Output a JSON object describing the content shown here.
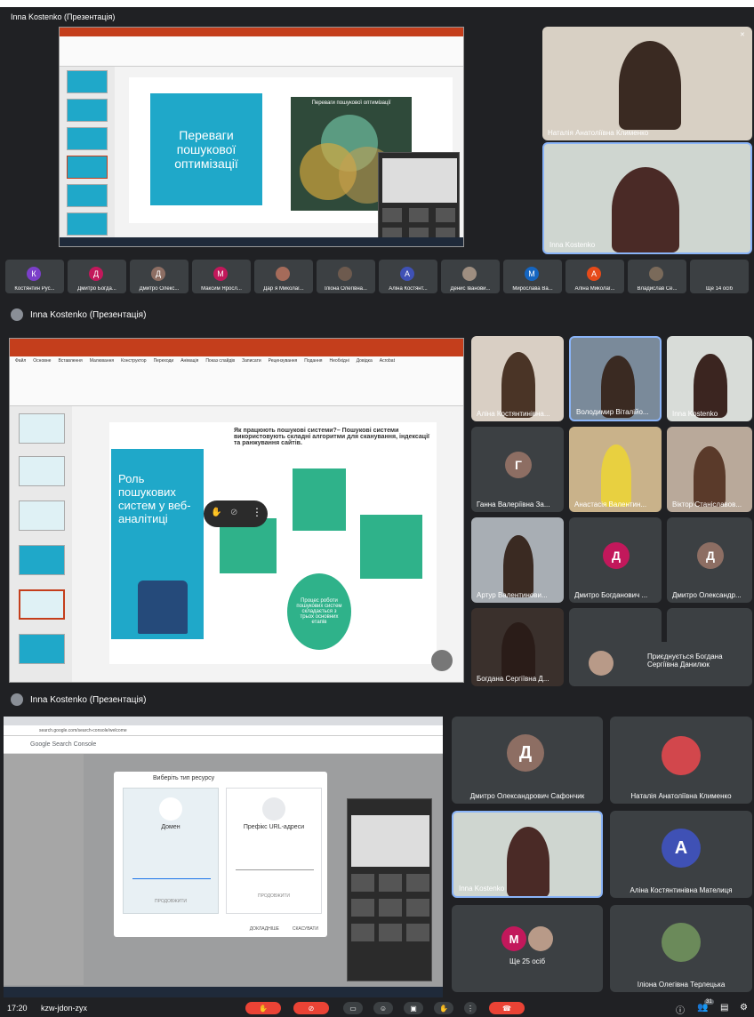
{
  "panel1": {
    "header": "Inna Kostenko (Презентація)",
    "slide_left_text": "Переваги пошукової оптимізації",
    "slide_right_title": "Переваги пошукової оптимізації",
    "tiles": [
      {
        "name": "Наталія Анатоліївна Клименко"
      },
      {
        "name": "Inna Kostenko"
      }
    ],
    "strip": [
      {
        "name": "Костянтин Рус...",
        "letter": "К",
        "color": "#7b3fc9"
      },
      {
        "name": "Дмитро Богда...",
        "letter": "Д",
        "color": "#c2185b"
      },
      {
        "name": "Дмитро Олекс...",
        "letter": "Д",
        "color": "#8d6e63"
      },
      {
        "name": "Максим Яросл...",
        "letter": "М",
        "color": "#c2185b"
      },
      {
        "name": "Дар`я Миколаї...",
        "letter": "",
        "color": ""
      },
      {
        "name": "Іліона Олегівна...",
        "letter": "",
        "color": ""
      },
      {
        "name": "Аліна Костянт...",
        "letter": "А",
        "color": "#3f51b5"
      },
      {
        "name": "Денис Іванови...",
        "letter": "",
        "color": ""
      },
      {
        "name": "Мирослава Ва...",
        "letter": "М",
        "color": "#1565c0"
      },
      {
        "name": "Аліна Миколаї...",
        "letter": "А",
        "color": "#e64a19"
      },
      {
        "name": "Владислав Се...",
        "letter": "",
        "color": ""
      },
      {
        "name": "Ще 14 осіб",
        "letter": "",
        "color": ""
      }
    ]
  },
  "panel2": {
    "header": "Inna Kostenko (Презентація)",
    "ribbon_tabs": [
      "Файл",
      "Основне",
      "Вставлення",
      "Малювання",
      "Конструктор",
      "Переходи",
      "Анімація",
      "Показ слайдів",
      "Записати",
      "Рецензування",
      "Подання",
      "Необхідні",
      "Довідка",
      "Acrobat"
    ],
    "slide_title": "Роль пошукових систем у веб-аналітиці",
    "slide_question": "Як працюють пошукові системи?– Пошукові системи використовують складні алгоритми для сканування, індексації та ранжування сайтів.",
    "slide_center": "Процес роботи пошукових систем складається з трьох основних етапів",
    "tiles": [
      {
        "name": "Аліна Костянтинівна..."
      },
      {
        "name": "Володимир Віталійо..."
      },
      {
        "name": "Inna Kostenko"
      },
      {
        "name": "Ганна Валеріївна За...",
        "letter": "Г",
        "color": "#8d6e63"
      },
      {
        "name": "Анастасія Валентин..."
      },
      {
        "name": "Віктор Станіславов..."
      },
      {
        "name": "Артур Валентинови..."
      },
      {
        "name": "Дмитро Богданович ...",
        "letter": "Д",
        "color": "#c2185b"
      },
      {
        "name": "Дмитро Олександр...",
        "letter": "Д",
        "color": "#8d6e63"
      },
      {
        "name": "Богдана Сергіївна Д..."
      }
    ],
    "join_toast": "Приєднується Богдана Сергіївна Данилюк"
  },
  "panel3": {
    "header": "Inna Kostenko (Презентація)",
    "browser_url": "search.google.com/search-console/welcome",
    "gsc_title": "Google Search Console",
    "dialog_title": "Виберіть тип ресурсу",
    "option1": "Домен",
    "option2": "Префікс URL-адреси",
    "continue1": "ПРОДОВЖИТИ",
    "continue2": "ПРОДОВЖИТИ",
    "learn_more": "ДОКЛАДНІШЕ",
    "cancel": "СКАСУВАТИ",
    "tiles": [
      {
        "name": "Дмитро Олександрович Сафончик",
        "letter": "Д",
        "color": "#8d6e63"
      },
      {
        "name": "Наталія Анатоліївна Клименко"
      },
      {
        "name": "Inna Kostenko"
      },
      {
        "name": "Аліна Костянтинівна Мателиця",
        "letter": "А",
        "color": "#3f51b5"
      },
      {
        "name": "Ще 25 осіб",
        "letter": "М",
        "color": "#c2185b"
      },
      {
        "name": "Іліона Олегівна Терлецька"
      }
    ]
  },
  "bottom": {
    "time": "17:20",
    "meeting_code": "kzw-jdon-zyx",
    "participants_badge": "31"
  }
}
